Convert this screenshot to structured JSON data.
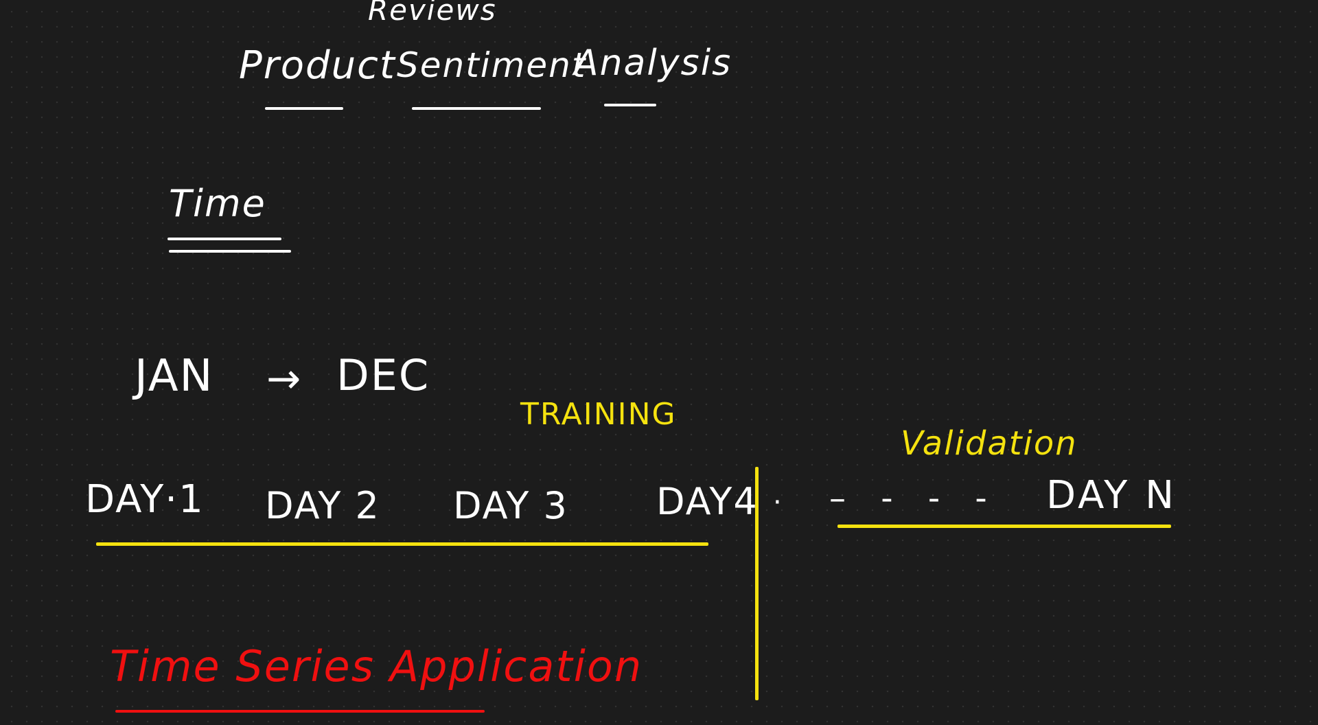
{
  "notes": {
    "top_word": "Reviews",
    "heading": {
      "word1": "Product",
      "word2": "Sentiment",
      "word3": "Analysis"
    },
    "time_label": "Time",
    "range": {
      "start": "JAN",
      "arrow": "→",
      "end": "DEC"
    },
    "training_label": "TRAINING",
    "validation_label": "Validation",
    "days": {
      "day1": "DAY·1",
      "day2": "DAY 2",
      "day3": "DAY 3",
      "day4": "DAY4",
      "dot": "·",
      "dashes": "–   -  -  -",
      "dayN": "DAY N"
    },
    "footer_title": "Time Series Application"
  },
  "colors": {
    "background": "#1c1c1c",
    "ink_white": "#ffffff",
    "ink_yellow": "#f5e20f",
    "ink_red": "#f01010"
  }
}
